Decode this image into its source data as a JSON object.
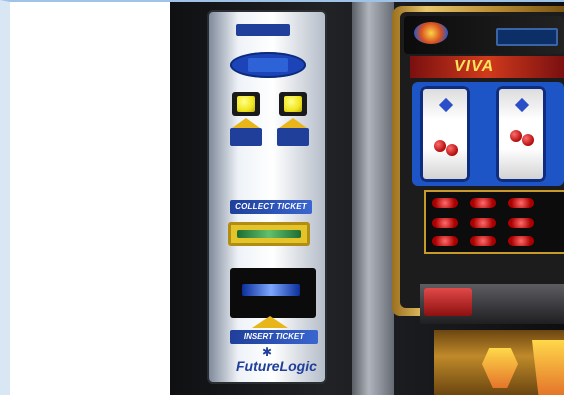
{
  "panel": {
    "brand_top": "",
    "button_left_label": "",
    "button_right_label": "",
    "collect_label": "COLLECT TICKET",
    "insert_label": "INSERT TICKET",
    "bezel_label": "",
    "logo": "FutureLogic"
  },
  "machine": {
    "title": "VIVA"
  },
  "colors": {
    "panel_blue": "#1f3f9a",
    "button_yellow": "#f1e51d",
    "gold_frame": "#c89a2a"
  }
}
